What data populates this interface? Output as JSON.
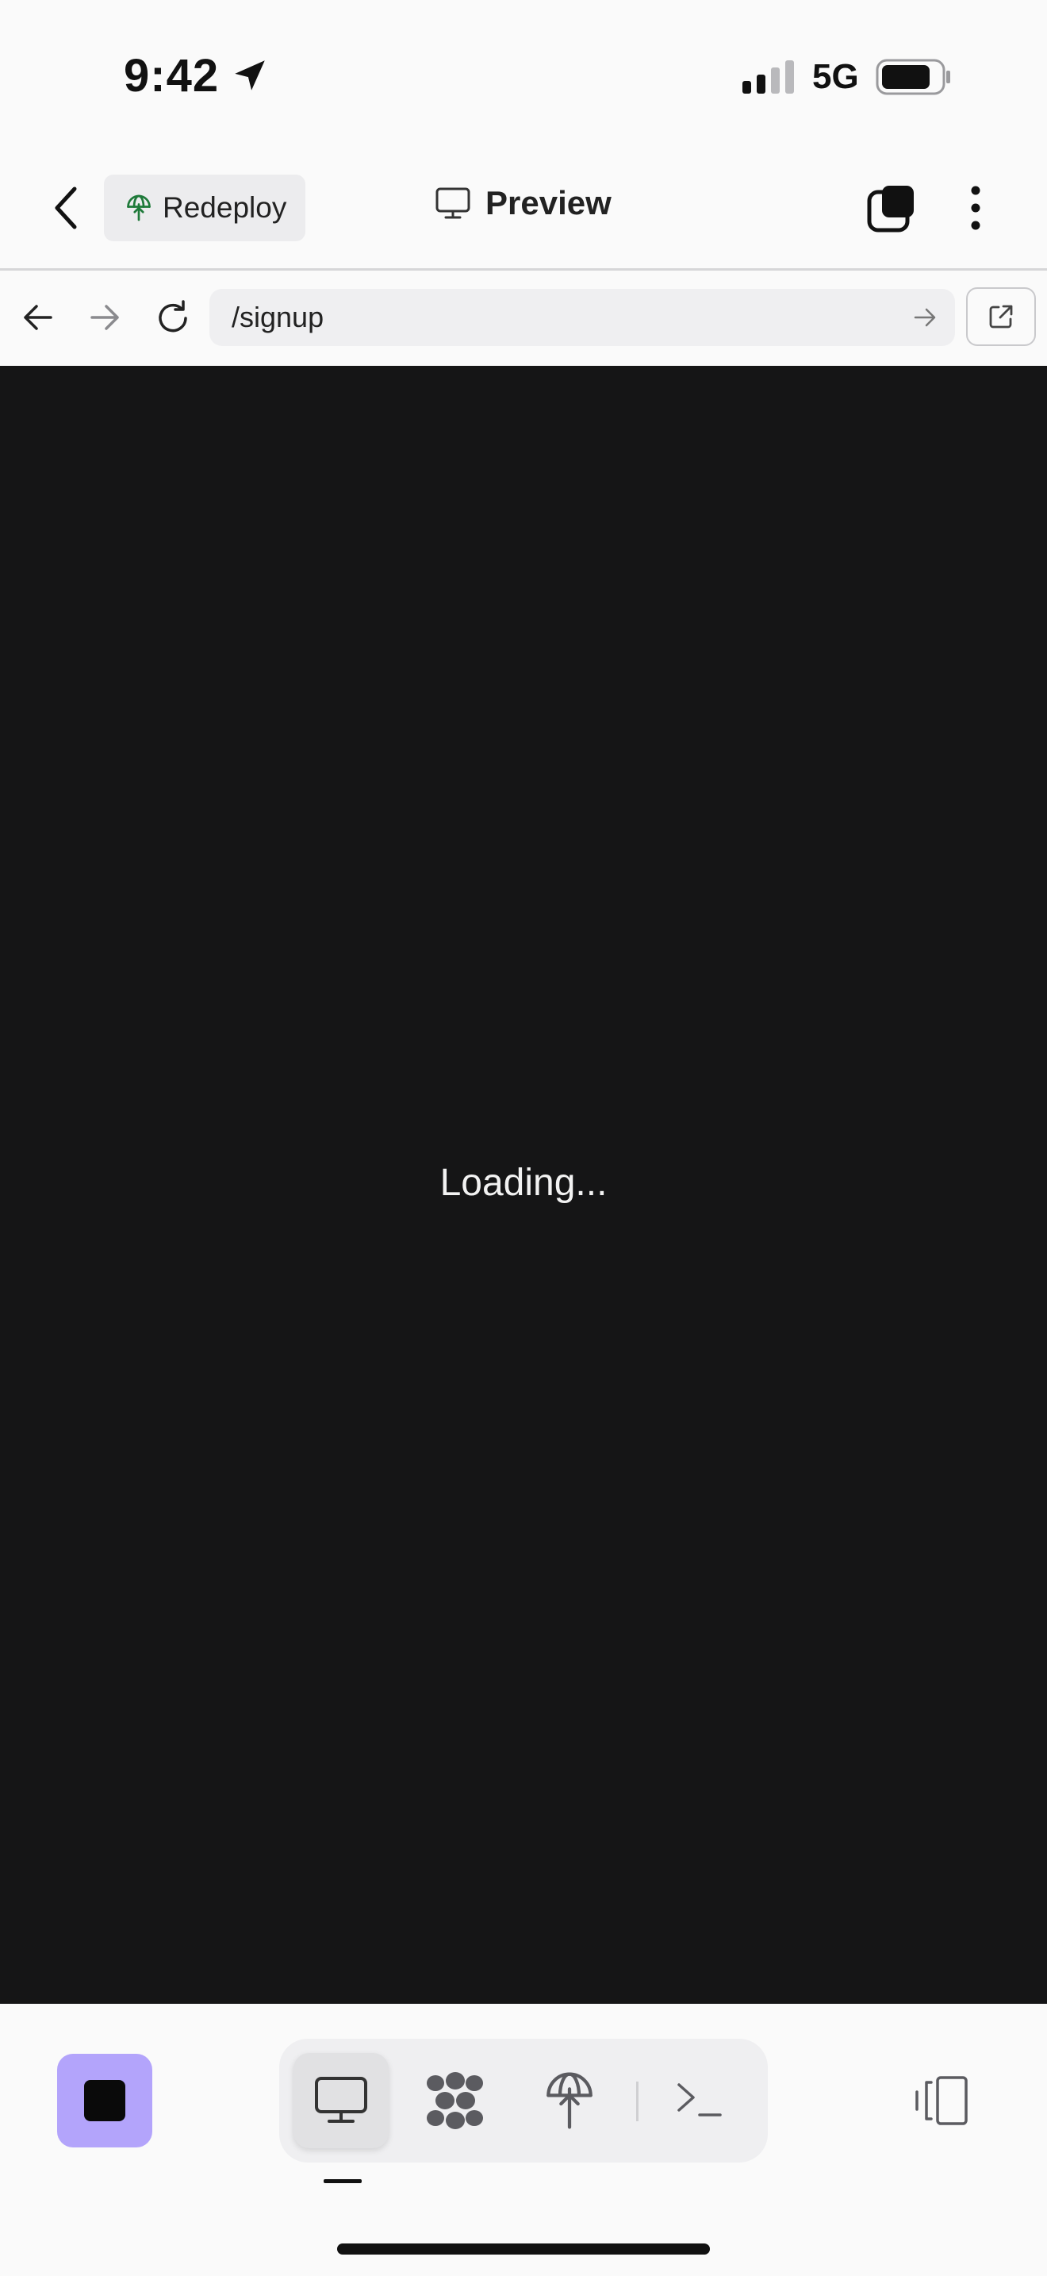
{
  "status_bar": {
    "time": "9:42",
    "network": "5G"
  },
  "header": {
    "redeploy_label": "Redeploy",
    "title": "Preview"
  },
  "browser": {
    "url": "/signup"
  },
  "preview": {
    "loading_text": "Loading..."
  },
  "colors": {
    "accent": "#b3a4fb",
    "preview_background": "#151516",
    "redeploy_icon": "#1f7a3a"
  },
  "icons": {
    "back": "chevron-left-icon",
    "tabs": "tabs-icon",
    "more": "more-vertical-icon",
    "nav_back": "arrow-left-icon",
    "nav_forward": "arrow-right-icon",
    "reload": "reload-icon",
    "go": "arrow-right-icon",
    "open_external": "external-link-icon",
    "stop": "stop-icon",
    "preview_tab": "monitor-icon",
    "packager_tab": "dots-cluster-icon",
    "deploy_tab": "deploy-icon",
    "console_tab": "terminal-icon",
    "device": "device-frame-icon"
  }
}
